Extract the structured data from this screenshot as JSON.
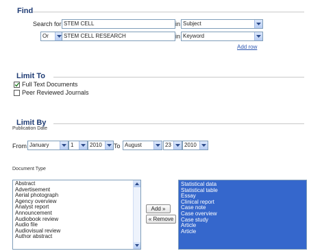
{
  "find": {
    "title": "Find",
    "search_for_label": "Search for",
    "row1": {
      "term": "STEM CELL",
      "in_label": "in",
      "field": "Subject"
    },
    "row2": {
      "operator": "Or",
      "term": "STEM CELL RESEARCH",
      "in_label": "in",
      "field": "Keyword"
    },
    "add_row": "Add row"
  },
  "limit_to": {
    "title": "Limit To",
    "options": [
      {
        "label": "Full Text Documents",
        "checked": true
      },
      {
        "label": "Peer Reviewed Journals",
        "checked": false
      }
    ]
  },
  "limit_by": {
    "title": "Limit By",
    "pub_date_label": "Publication Date",
    "from_label": "From",
    "to_label": "To",
    "from": {
      "month": "January",
      "day": "1",
      "year": "2010"
    },
    "to": {
      "month": "August",
      "day": "23",
      "year": "2010"
    },
    "doc_type_label": "Document Type",
    "available": [
      "Abstract",
      "Advertisement",
      "Aerial photograph",
      "Agency overview",
      "Analyst report",
      "Announcement",
      "Audiobook review",
      "Audio file",
      "Audiovisual review",
      "Author abstract"
    ],
    "selected": [
      "Statistical data",
      "Statistical table",
      "Essay",
      "Clinical report",
      "Case note",
      "Case overview",
      "Case study",
      "Article",
      "Article"
    ],
    "add_button": "Add »",
    "remove_button": "« Remove"
  },
  "colors": {
    "title": "#1d3a73",
    "link": "#2a55b0",
    "selection": "#3567cc"
  }
}
